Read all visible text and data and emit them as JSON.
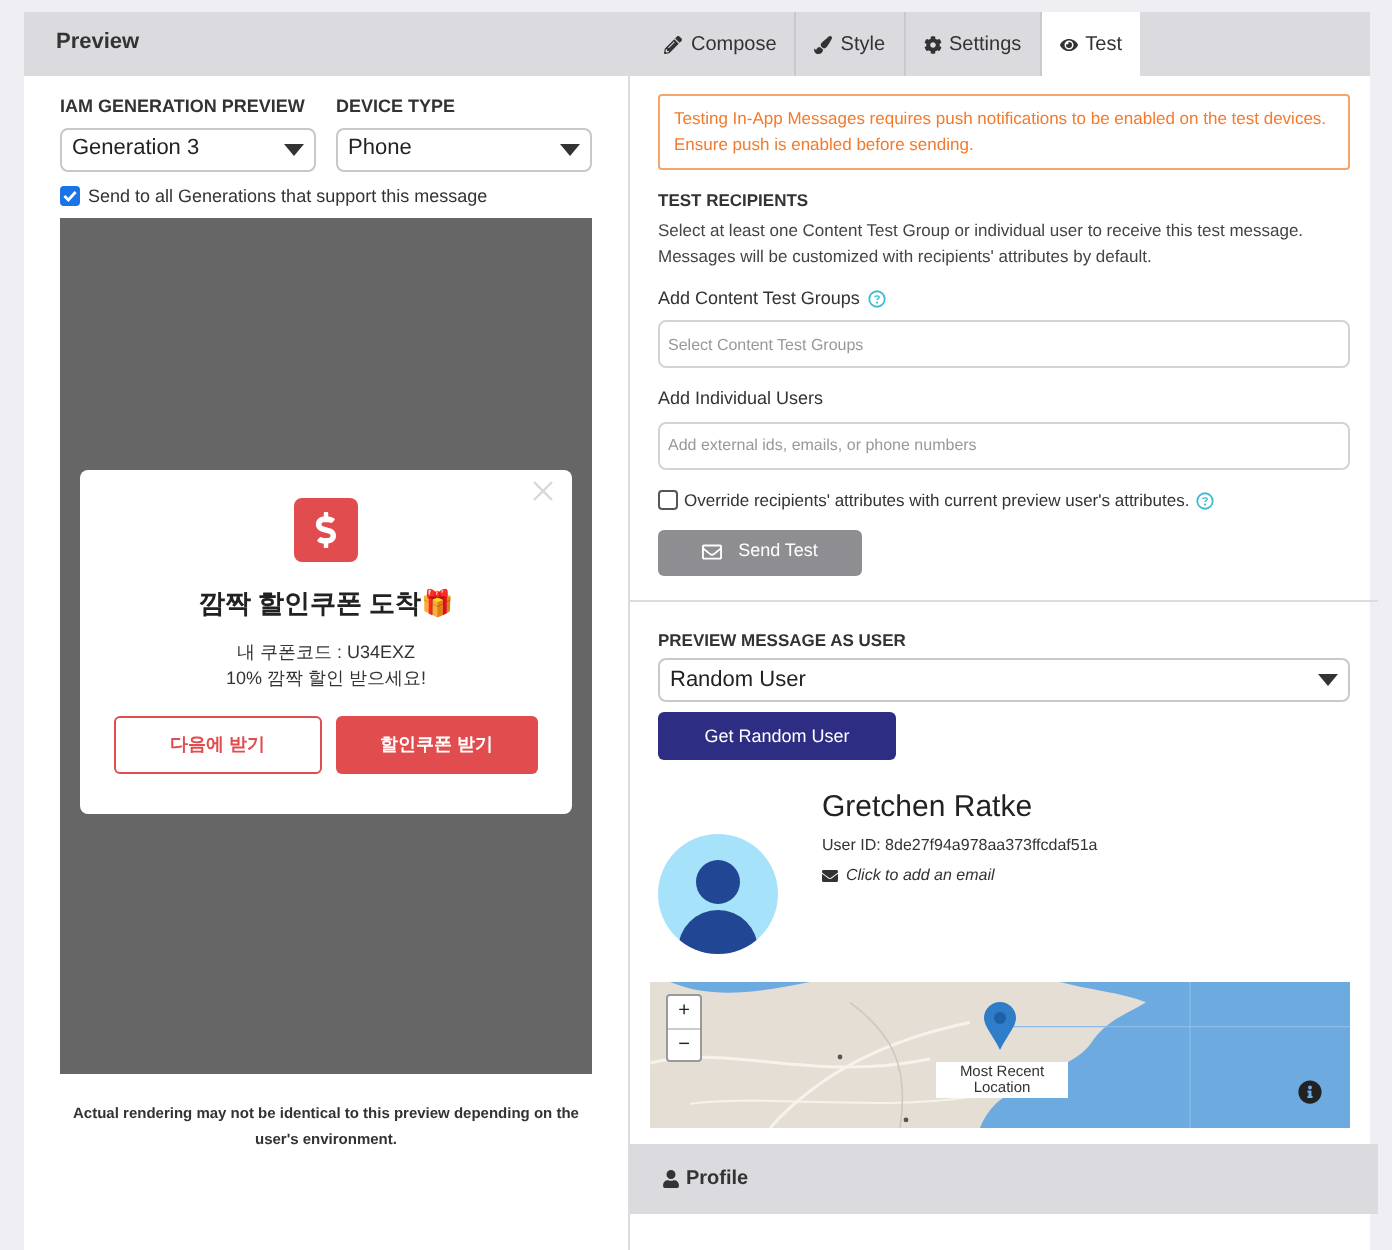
{
  "header": {
    "title": "Preview"
  },
  "tabs": [
    {
      "label": "Compose",
      "selected": false
    },
    {
      "label": "Style",
      "selected": false
    },
    {
      "label": "Settings",
      "selected": false
    },
    {
      "label": "Test",
      "selected": true
    }
  ],
  "preview": {
    "generation": {
      "label": "IAM GENERATION PREVIEW",
      "value": "Generation 3"
    },
    "device": {
      "label": "DEVICE TYPE",
      "value": "Phone"
    },
    "send_all": {
      "label": "Send to all Generations that support this message",
      "checked": true
    },
    "message": {
      "title": "깜짝 할인쿠폰 도착🎁",
      "lines": [
        "내 쿠폰코드 : U34EXZ",
        "10% 깜짝 할인 받으세요!"
      ],
      "buttons": [
        {
          "label": "다음에 받기",
          "kind": "outline"
        },
        {
          "label": "할인쿠폰 받기",
          "kind": "filled"
        }
      ]
    },
    "disclaimer": "Actual rendering may not be identical to this preview depending on the user's environment."
  },
  "test": {
    "warning": "Testing In-App Messages requires push notifications to be enabled on the test devices. Ensure push is enabled before sending.",
    "recipients_title": "TEST RECIPIENTS",
    "recipients_text": "Select at least one Content Test Group or individual user to receive this test message. Messages will be customized with recipients' attributes by default.",
    "groups": {
      "label": "Add Content Test Groups",
      "placeholder": "Select Content Test Groups"
    },
    "users": {
      "label": "Add Individual Users",
      "placeholder": "Add external ids, emails, or phone numbers"
    },
    "override": {
      "label": "Override recipients' attributes with current preview user's attributes.",
      "checked": false
    },
    "send_button": {
      "label": "Send Test",
      "disabled": true
    }
  },
  "preview_user": {
    "title": "PREVIEW MESSAGE AS USER",
    "value": "Random User",
    "button": "Get Random User",
    "name": "Gretchen Ratke",
    "user_id": "User ID: 8de27f94a978aa373ffcdaf51a",
    "email": "Click to add an email",
    "map": {
      "zoom_in": "+",
      "zoom_out": "−",
      "tooltip": "Most Recent Location"
    }
  },
  "profile": {
    "title": "Profile"
  }
}
